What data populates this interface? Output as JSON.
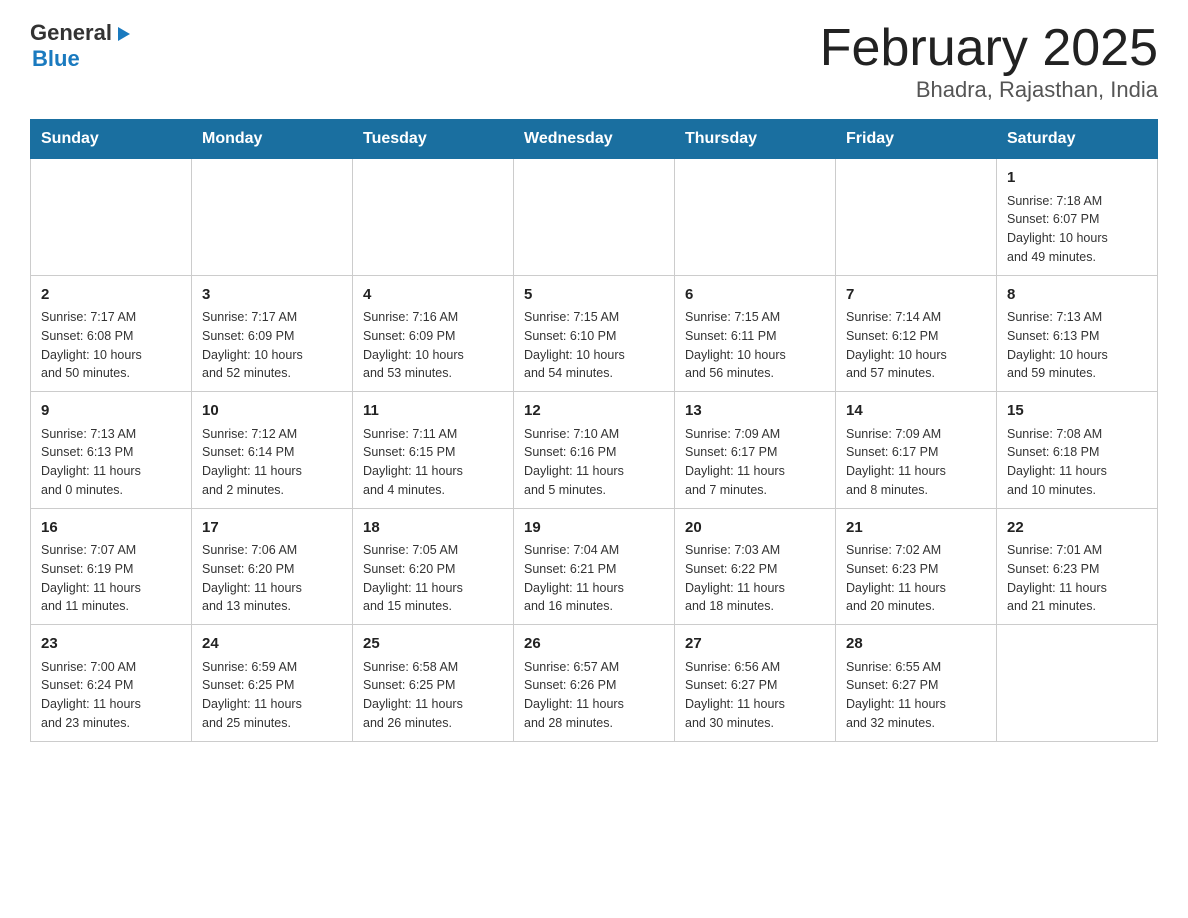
{
  "header": {
    "logo": {
      "general": "General",
      "blue": "Blue",
      "triangle": "▶"
    },
    "title": "February 2025",
    "subtitle": "Bhadra, Rajasthan, India"
  },
  "weekdays": [
    "Sunday",
    "Monday",
    "Tuesday",
    "Wednesday",
    "Thursday",
    "Friday",
    "Saturday"
  ],
  "weeks": [
    {
      "days": [
        {
          "date": "",
          "info": ""
        },
        {
          "date": "",
          "info": ""
        },
        {
          "date": "",
          "info": ""
        },
        {
          "date": "",
          "info": ""
        },
        {
          "date": "",
          "info": ""
        },
        {
          "date": "",
          "info": ""
        },
        {
          "date": "1",
          "info": "Sunrise: 7:18 AM\nSunset: 6:07 PM\nDaylight: 10 hours\nand 49 minutes."
        }
      ]
    },
    {
      "days": [
        {
          "date": "2",
          "info": "Sunrise: 7:17 AM\nSunset: 6:08 PM\nDaylight: 10 hours\nand 50 minutes."
        },
        {
          "date": "3",
          "info": "Sunrise: 7:17 AM\nSunset: 6:09 PM\nDaylight: 10 hours\nand 52 minutes."
        },
        {
          "date": "4",
          "info": "Sunrise: 7:16 AM\nSunset: 6:09 PM\nDaylight: 10 hours\nand 53 minutes."
        },
        {
          "date": "5",
          "info": "Sunrise: 7:15 AM\nSunset: 6:10 PM\nDaylight: 10 hours\nand 54 minutes."
        },
        {
          "date": "6",
          "info": "Sunrise: 7:15 AM\nSunset: 6:11 PM\nDaylight: 10 hours\nand 56 minutes."
        },
        {
          "date": "7",
          "info": "Sunrise: 7:14 AM\nSunset: 6:12 PM\nDaylight: 10 hours\nand 57 minutes."
        },
        {
          "date": "8",
          "info": "Sunrise: 7:13 AM\nSunset: 6:13 PM\nDaylight: 10 hours\nand 59 minutes."
        }
      ]
    },
    {
      "days": [
        {
          "date": "9",
          "info": "Sunrise: 7:13 AM\nSunset: 6:13 PM\nDaylight: 11 hours\nand 0 minutes."
        },
        {
          "date": "10",
          "info": "Sunrise: 7:12 AM\nSunset: 6:14 PM\nDaylight: 11 hours\nand 2 minutes."
        },
        {
          "date": "11",
          "info": "Sunrise: 7:11 AM\nSunset: 6:15 PM\nDaylight: 11 hours\nand 4 minutes."
        },
        {
          "date": "12",
          "info": "Sunrise: 7:10 AM\nSunset: 6:16 PM\nDaylight: 11 hours\nand 5 minutes."
        },
        {
          "date": "13",
          "info": "Sunrise: 7:09 AM\nSunset: 6:17 PM\nDaylight: 11 hours\nand 7 minutes."
        },
        {
          "date": "14",
          "info": "Sunrise: 7:09 AM\nSunset: 6:17 PM\nDaylight: 11 hours\nand 8 minutes."
        },
        {
          "date": "15",
          "info": "Sunrise: 7:08 AM\nSunset: 6:18 PM\nDaylight: 11 hours\nand 10 minutes."
        }
      ]
    },
    {
      "days": [
        {
          "date": "16",
          "info": "Sunrise: 7:07 AM\nSunset: 6:19 PM\nDaylight: 11 hours\nand 11 minutes."
        },
        {
          "date": "17",
          "info": "Sunrise: 7:06 AM\nSunset: 6:20 PM\nDaylight: 11 hours\nand 13 minutes."
        },
        {
          "date": "18",
          "info": "Sunrise: 7:05 AM\nSunset: 6:20 PM\nDaylight: 11 hours\nand 15 minutes."
        },
        {
          "date": "19",
          "info": "Sunrise: 7:04 AM\nSunset: 6:21 PM\nDaylight: 11 hours\nand 16 minutes."
        },
        {
          "date": "20",
          "info": "Sunrise: 7:03 AM\nSunset: 6:22 PM\nDaylight: 11 hours\nand 18 minutes."
        },
        {
          "date": "21",
          "info": "Sunrise: 7:02 AM\nSunset: 6:23 PM\nDaylight: 11 hours\nand 20 minutes."
        },
        {
          "date": "22",
          "info": "Sunrise: 7:01 AM\nSunset: 6:23 PM\nDaylight: 11 hours\nand 21 minutes."
        }
      ]
    },
    {
      "days": [
        {
          "date": "23",
          "info": "Sunrise: 7:00 AM\nSunset: 6:24 PM\nDaylight: 11 hours\nand 23 minutes."
        },
        {
          "date": "24",
          "info": "Sunrise: 6:59 AM\nSunset: 6:25 PM\nDaylight: 11 hours\nand 25 minutes."
        },
        {
          "date": "25",
          "info": "Sunrise: 6:58 AM\nSunset: 6:25 PM\nDaylight: 11 hours\nand 26 minutes."
        },
        {
          "date": "26",
          "info": "Sunrise: 6:57 AM\nSunset: 6:26 PM\nDaylight: 11 hours\nand 28 minutes."
        },
        {
          "date": "27",
          "info": "Sunrise: 6:56 AM\nSunset: 6:27 PM\nDaylight: 11 hours\nand 30 minutes."
        },
        {
          "date": "28",
          "info": "Sunrise: 6:55 AM\nSunset: 6:27 PM\nDaylight: 11 hours\nand 32 minutes."
        },
        {
          "date": "",
          "info": ""
        }
      ]
    }
  ]
}
